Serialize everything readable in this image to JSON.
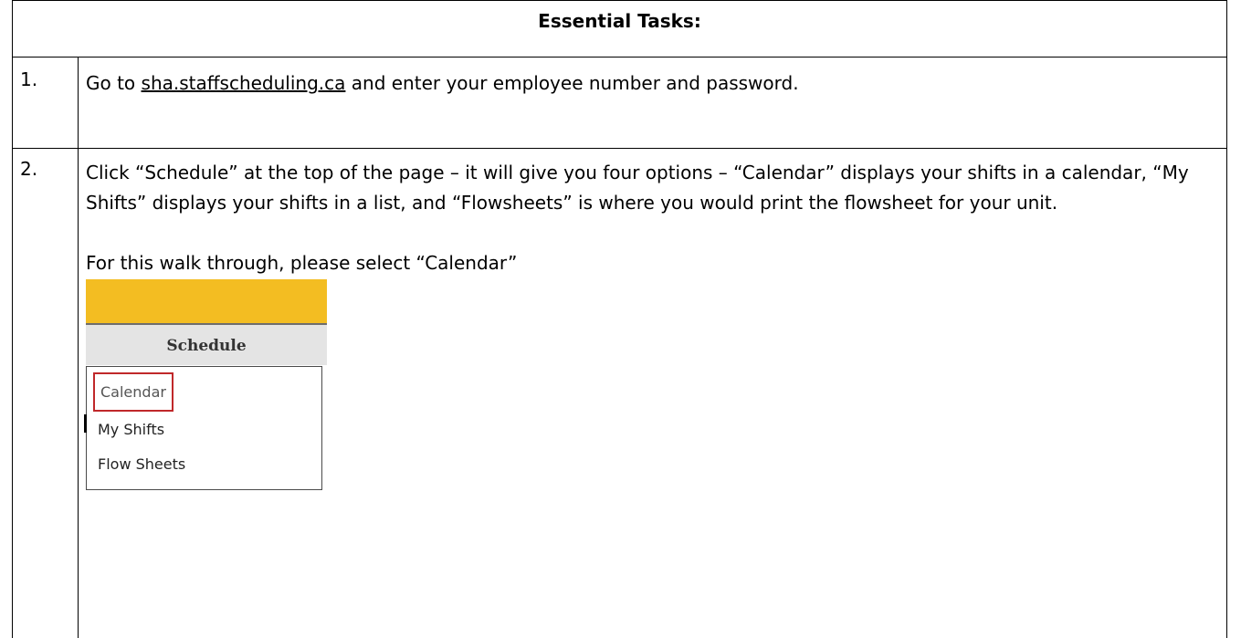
{
  "table": {
    "header": "Essential Tasks:",
    "rows": [
      {
        "number": "1.",
        "text_before_link": "Go to ",
        "link": "sha.staffscheduling.ca",
        "text_after_link": " and enter your employee number and password."
      },
      {
        "number": "2.",
        "paragraph": "Click “Schedule” at the top of the page – it will give you four options – “Calendar” displays your shifts in a calendar, “My Shifts” displays your shifts in a list, and “Flowsheets” is where you would print the flowsheet for your unit.",
        "instruction": "For this walk through, please select “Calendar”"
      }
    ]
  },
  "menu_screenshot": {
    "header": "Schedule",
    "items": [
      "Calendar",
      "My Shifts",
      "Flow Sheets"
    ],
    "highlighted_item": "Calendar",
    "colors": {
      "banner": "#f3bd22",
      "header_bg": "#e4e4e4",
      "highlight_border": "#c0282a"
    }
  }
}
